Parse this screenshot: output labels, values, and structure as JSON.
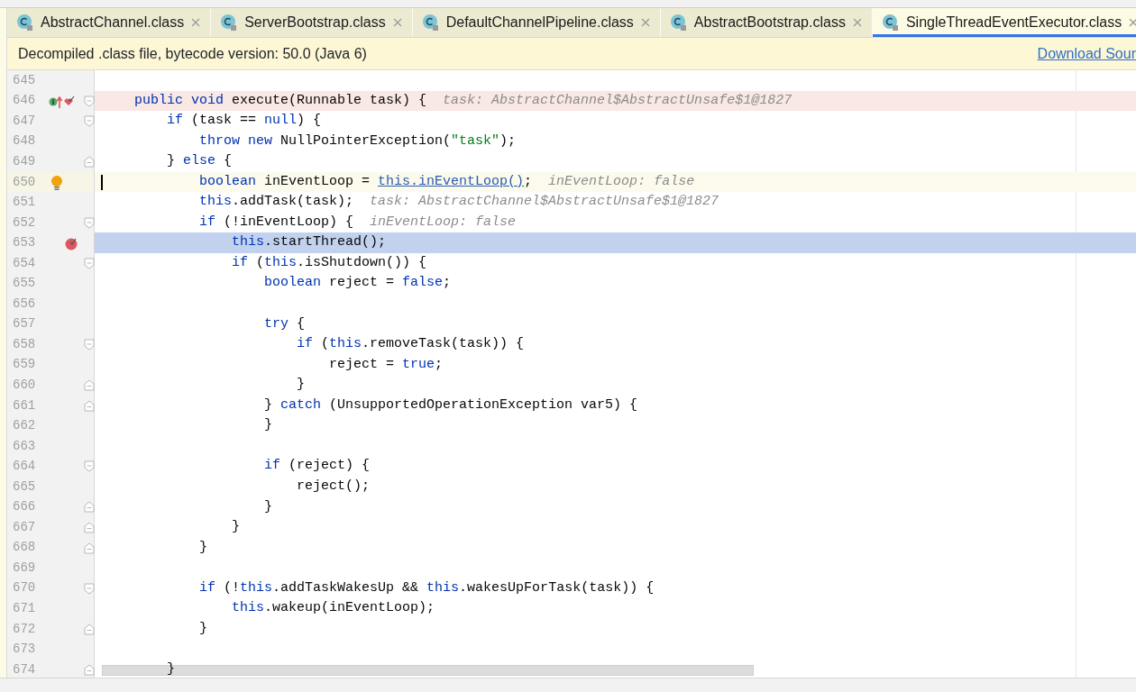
{
  "tabs": [
    {
      "label": "AbstractChannel.class",
      "selected": false
    },
    {
      "label": "ServerBootstrap.class",
      "selected": false
    },
    {
      "label": "DefaultChannelPipeline.class",
      "selected": false
    },
    {
      "label": "AbstractBootstrap.class",
      "selected": false
    },
    {
      "label": "SingleThreadEventExecutor.class",
      "selected": true
    }
  ],
  "banner": {
    "message": "Decompiled .class file, bytecode version: 50.0 (Java 6)",
    "link": "Download Sour"
  },
  "lines": [
    {
      "number": "645",
      "method_breakpoint": false,
      "line_breakpoint": false,
      "current": false,
      "caret": false,
      "fold_start": false,
      "fold_end": false
    },
    {
      "number": "646",
      "method_breakpoint": true,
      "line_breakpoint": false,
      "current": false,
      "caret": false,
      "fold_start": true,
      "fold_end": false,
      "code": [
        {
          "kind": "k",
          "text": "    public void "
        },
        {
          "kind": "t",
          "text": "execute(Runnable task) {"
        }
      ],
      "hint": "task: AbstractChannel$AbstractUnsafe$1@1827"
    },
    {
      "number": "647",
      "method_breakpoint": false,
      "line_breakpoint": false,
      "current": false,
      "caret": false,
      "fold_start": true,
      "fold_end": false,
      "code": [
        {
          "kind": "k",
          "text": "        if "
        },
        {
          "kind": "t",
          "text": "(task == "
        },
        {
          "kind": "k",
          "text": "null"
        },
        {
          "kind": "t",
          "text": ") {"
        }
      ]
    },
    {
      "number": "648",
      "method_breakpoint": false,
      "line_breakpoint": false,
      "current": false,
      "caret": false,
      "fold_start": false,
      "fold_end": false,
      "code": [
        {
          "kind": "k",
          "text": "            throw new "
        },
        {
          "kind": "t",
          "text": "NullPointerException("
        },
        {
          "kind": "s",
          "text": "\"task\""
        },
        {
          "kind": "t",
          "text": ");"
        }
      ]
    },
    {
      "number": "649",
      "method_breakpoint": false,
      "line_breakpoint": false,
      "current": false,
      "caret": false,
      "fold_start": false,
      "fold_end": true,
      "code": [
        {
          "kind": "t",
          "text": "        } "
        },
        {
          "kind": "k",
          "text": "else"
        },
        {
          "kind": "t",
          "text": " {"
        }
      ]
    },
    {
      "number": "650",
      "method_breakpoint": false,
      "line_breakpoint": false,
      "current": false,
      "caret": true,
      "fold_start": false,
      "fold_end": false,
      "code": [
        {
          "kind": "k",
          "text": "            boolean "
        },
        {
          "kind": "t",
          "text": "inEventLoop = "
        },
        {
          "kind": "u",
          "text": "this.inEventLoop()"
        },
        {
          "kind": "t",
          "text": ";"
        }
      ],
      "hint": "inEventLoop: false"
    },
    {
      "number": "651",
      "method_breakpoint": false,
      "line_breakpoint": false,
      "current": false,
      "caret": false,
      "fold_start": false,
      "fold_end": false,
      "code": [
        {
          "kind": "k",
          "text": "            this"
        },
        {
          "kind": "t",
          "text": ".addTask(task);"
        }
      ],
      "hint": "task: AbstractChannel$AbstractUnsafe$1@1827"
    },
    {
      "number": "652",
      "method_breakpoint": false,
      "line_breakpoint": false,
      "current": false,
      "caret": false,
      "fold_start": true,
      "fold_end": false,
      "code": [
        {
          "kind": "k",
          "text": "            if "
        },
        {
          "kind": "t",
          "text": "(!inEventLoop) {"
        }
      ],
      "hint": "inEventLoop: false"
    },
    {
      "number": "653",
      "method_breakpoint": false,
      "line_breakpoint": true,
      "current": true,
      "caret": false,
      "fold_start": false,
      "fold_end": false,
      "code": [
        {
          "kind": "k",
          "text": "                this"
        },
        {
          "kind": "t",
          "text": ".startThread();"
        }
      ]
    },
    {
      "number": "654",
      "method_breakpoint": false,
      "line_breakpoint": false,
      "current": false,
      "caret": false,
      "fold_start": true,
      "fold_end": false,
      "code": [
        {
          "kind": "k",
          "text": "                if "
        },
        {
          "kind": "t",
          "text": "("
        },
        {
          "kind": "k",
          "text": "this"
        },
        {
          "kind": "t",
          "text": ".isShutdown()) {"
        }
      ]
    },
    {
      "number": "655",
      "method_breakpoint": false,
      "line_breakpoint": false,
      "current": false,
      "caret": false,
      "fold_start": false,
      "fold_end": false,
      "code": [
        {
          "kind": "k",
          "text": "                    boolean "
        },
        {
          "kind": "t",
          "text": "reject = "
        },
        {
          "kind": "k",
          "text": "false"
        },
        {
          "kind": "t",
          "text": ";"
        }
      ]
    },
    {
      "number": "656",
      "method_breakpoint": false,
      "line_breakpoint": false,
      "current": false,
      "caret": false,
      "fold_start": false,
      "fold_end": false
    },
    {
      "number": "657",
      "method_breakpoint": false,
      "line_breakpoint": false,
      "current": false,
      "caret": false,
      "fold_start": false,
      "fold_end": false,
      "code": [
        {
          "kind": "k",
          "text": "                    try "
        },
        {
          "kind": "t",
          "text": "{"
        }
      ]
    },
    {
      "number": "658",
      "method_breakpoint": false,
      "line_breakpoint": false,
      "current": false,
      "caret": false,
      "fold_start": true,
      "fold_end": false,
      "code": [
        {
          "kind": "k",
          "text": "                        if "
        },
        {
          "kind": "t",
          "text": "("
        },
        {
          "kind": "k",
          "text": "this"
        },
        {
          "kind": "t",
          "text": ".removeTask(task)) {"
        }
      ]
    },
    {
      "number": "659",
      "method_breakpoint": false,
      "line_breakpoint": false,
      "current": false,
      "caret": false,
      "fold_start": false,
      "fold_end": false,
      "code": [
        {
          "kind": "t",
          "text": "                            reject = "
        },
        {
          "kind": "k",
          "text": "true"
        },
        {
          "kind": "t",
          "text": ";"
        }
      ]
    },
    {
      "number": "660",
      "method_breakpoint": false,
      "line_breakpoint": false,
      "current": false,
      "caret": false,
      "fold_start": false,
      "fold_end": true,
      "code": [
        {
          "kind": "t",
          "text": "                        }"
        }
      ]
    },
    {
      "number": "661",
      "method_breakpoint": false,
      "line_breakpoint": false,
      "current": false,
      "caret": false,
      "fold_start": false,
      "fold_end": true,
      "code": [
        {
          "kind": "t",
          "text": "                    } "
        },
        {
          "kind": "k",
          "text": "catch "
        },
        {
          "kind": "t",
          "text": "(UnsupportedOperationException var5) {"
        }
      ]
    },
    {
      "number": "662",
      "method_breakpoint": false,
      "line_breakpoint": false,
      "current": false,
      "caret": false,
      "fold_start": false,
      "fold_end": false,
      "code": [
        {
          "kind": "t",
          "text": "                    }"
        }
      ]
    },
    {
      "number": "663",
      "method_breakpoint": false,
      "line_breakpoint": false,
      "current": false,
      "caret": false,
      "fold_start": false,
      "fold_end": false
    },
    {
      "number": "664",
      "method_breakpoint": false,
      "line_breakpoint": false,
      "current": false,
      "caret": false,
      "fold_start": true,
      "fold_end": false,
      "code": [
        {
          "kind": "k",
          "text": "                    if "
        },
        {
          "kind": "t",
          "text": "(reject) {"
        }
      ]
    },
    {
      "number": "665",
      "method_breakpoint": false,
      "line_breakpoint": false,
      "current": false,
      "caret": false,
      "fold_start": false,
      "fold_end": false,
      "code": [
        {
          "kind": "t",
          "text": "                        reject();"
        }
      ]
    },
    {
      "number": "666",
      "method_breakpoint": false,
      "line_breakpoint": false,
      "current": false,
      "caret": false,
      "fold_start": false,
      "fold_end": true,
      "code": [
        {
          "kind": "t",
          "text": "                    }"
        }
      ]
    },
    {
      "number": "667",
      "method_breakpoint": false,
      "line_breakpoint": false,
      "current": false,
      "caret": false,
      "fold_start": false,
      "fold_end": true,
      "code": [
        {
          "kind": "t",
          "text": "                }"
        }
      ]
    },
    {
      "number": "668",
      "method_breakpoint": false,
      "line_breakpoint": false,
      "current": false,
      "caret": false,
      "fold_start": false,
      "fold_end": true,
      "code": [
        {
          "kind": "t",
          "text": "            }"
        }
      ]
    },
    {
      "number": "669",
      "method_breakpoint": false,
      "line_breakpoint": false,
      "current": false,
      "caret": false,
      "fold_start": false,
      "fold_end": false
    },
    {
      "number": "670",
      "method_breakpoint": false,
      "line_breakpoint": false,
      "current": false,
      "caret": false,
      "fold_start": true,
      "fold_end": false,
      "code": [
        {
          "kind": "k",
          "text": "            if "
        },
        {
          "kind": "t",
          "text": "(!"
        },
        {
          "kind": "k",
          "text": "this"
        },
        {
          "kind": "t",
          "text": ".addTaskWakesUp && "
        },
        {
          "kind": "k",
          "text": "this"
        },
        {
          "kind": "t",
          "text": ".wakesUpForTask(task)) {"
        }
      ]
    },
    {
      "number": "671",
      "method_breakpoint": false,
      "line_breakpoint": false,
      "current": false,
      "caret": false,
      "fold_start": false,
      "fold_end": false,
      "code": [
        {
          "kind": "k",
          "text": "                this"
        },
        {
          "kind": "t",
          "text": ".wakeup(inEventLoop);"
        }
      ]
    },
    {
      "number": "672",
      "method_breakpoint": false,
      "line_breakpoint": false,
      "current": false,
      "caret": false,
      "fold_start": false,
      "fold_end": true,
      "code": [
        {
          "kind": "t",
          "text": "            }"
        }
      ]
    },
    {
      "number": "673",
      "method_breakpoint": false,
      "line_breakpoint": false,
      "current": false,
      "caret": false,
      "fold_start": false,
      "fold_end": false
    },
    {
      "number": "674",
      "method_breakpoint": false,
      "line_breakpoint": false,
      "current": false,
      "caret": false,
      "fold_start": false,
      "fold_end": true,
      "code": [
        {
          "kind": "t",
          "text": "        }"
        }
      ]
    }
  ]
}
